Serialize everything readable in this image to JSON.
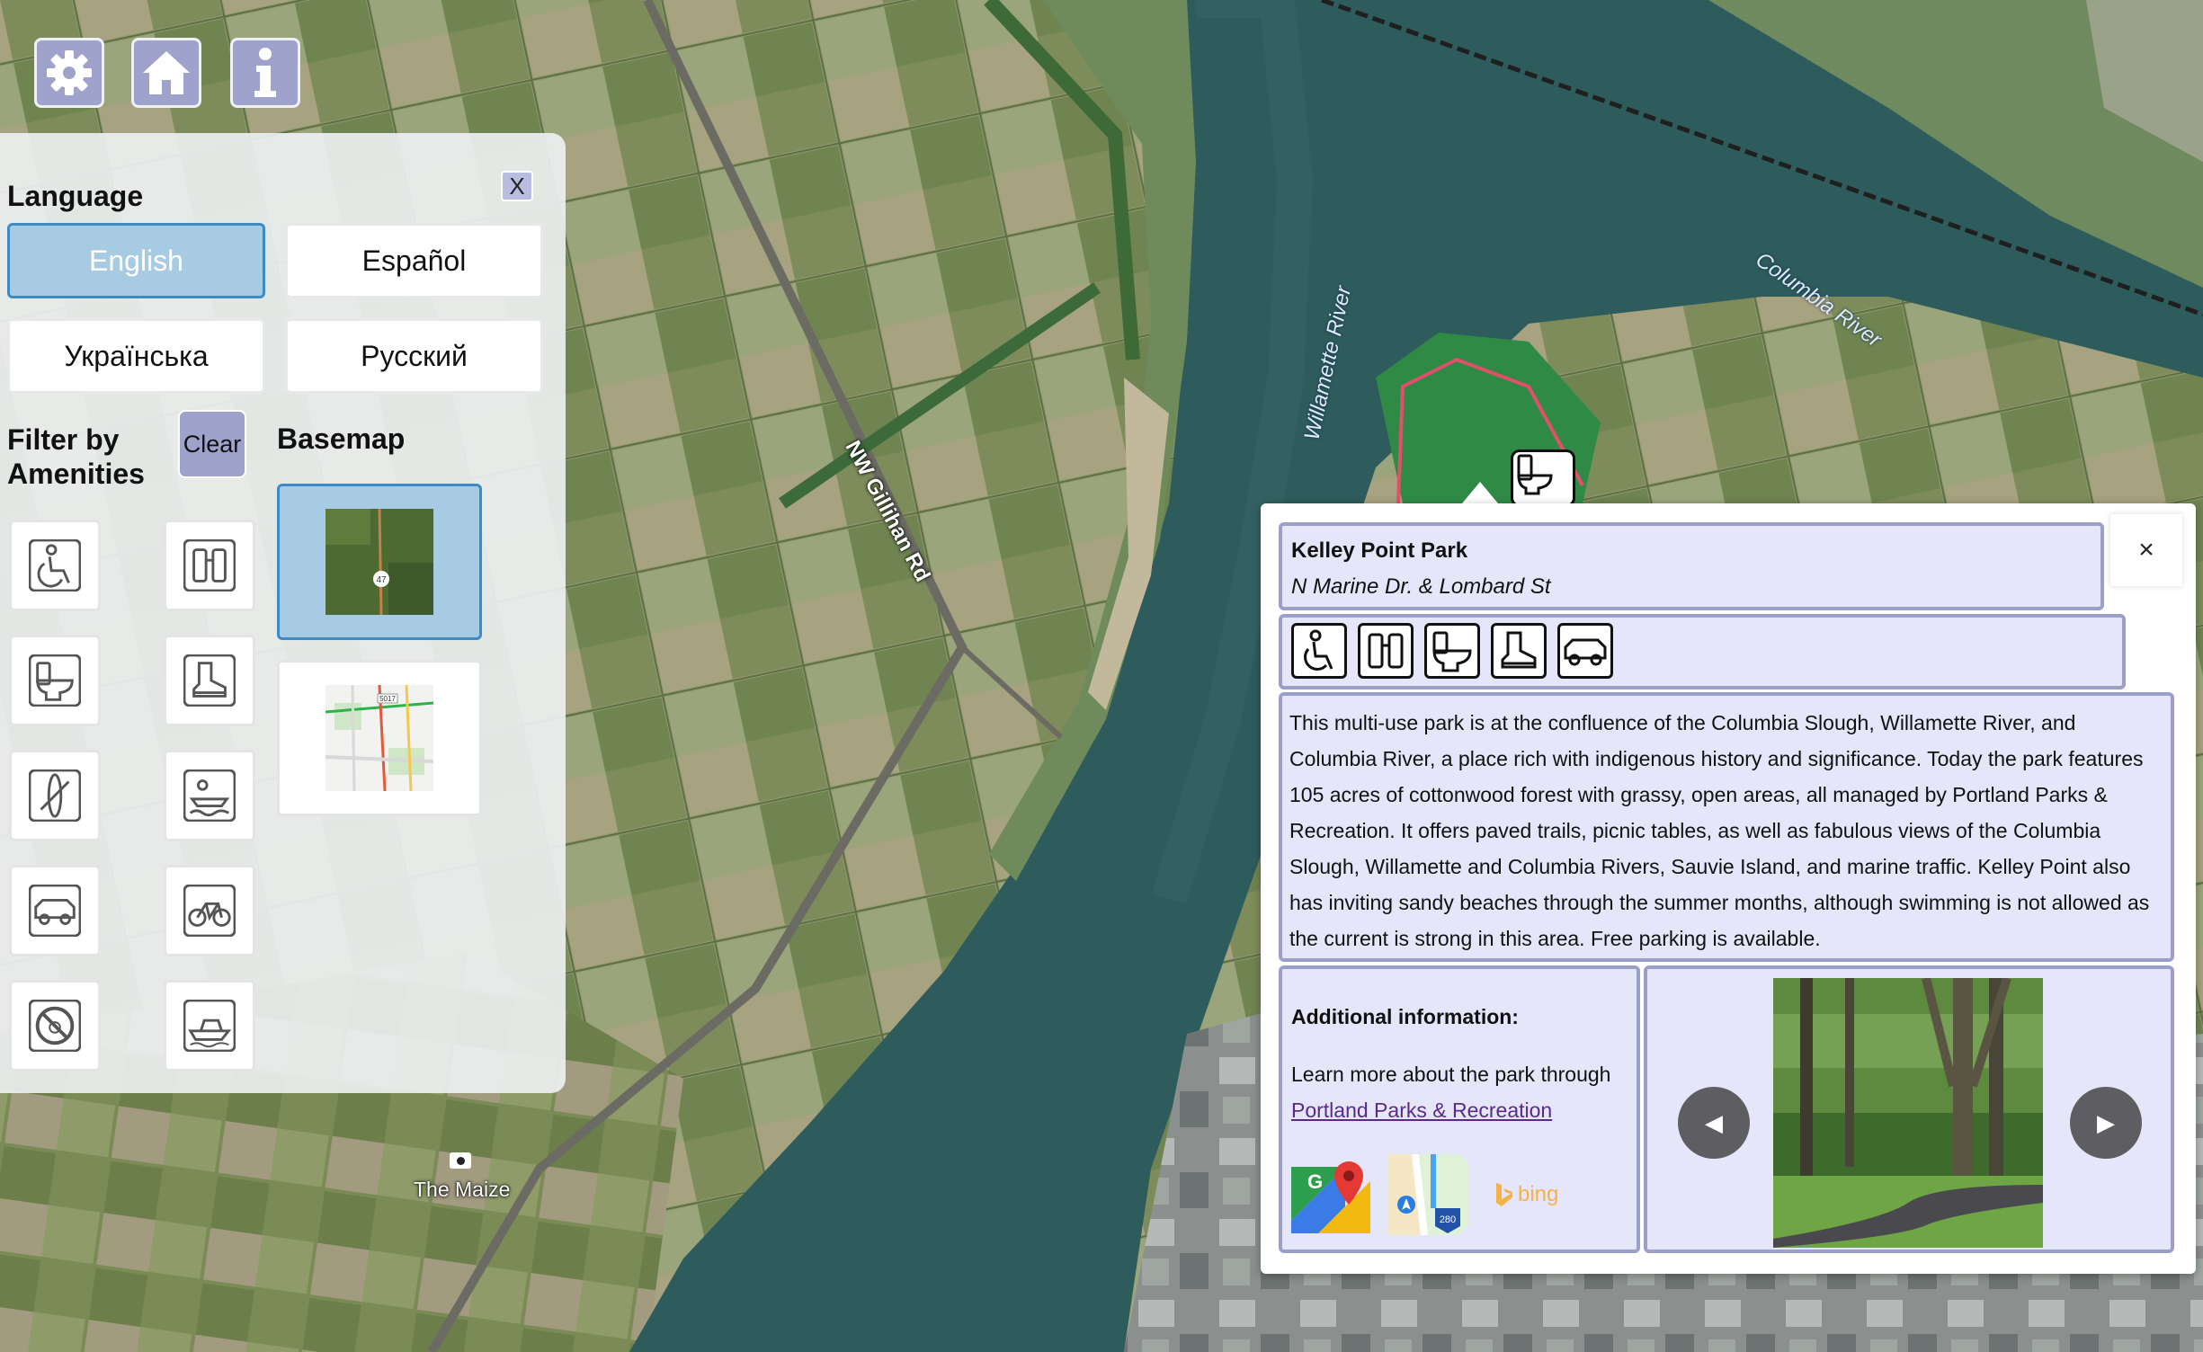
{
  "toolbar": {
    "settings_icon": "gear-icon",
    "home_icon": "home-icon",
    "info_icon": "info-icon",
    "button_color": "#9fa3cc"
  },
  "panel": {
    "close_label": "X",
    "language_title": "Language",
    "languages": [
      {
        "label": "English",
        "active": true
      },
      {
        "label": "Español",
        "active": false
      },
      {
        "label": "Українська",
        "active": false
      },
      {
        "label": "Русский",
        "active": false
      }
    ],
    "filter_title_line1": "Filter by",
    "filter_title_line2": "Amenities",
    "clear_label": "Clear",
    "basemap_title": "Basemap",
    "amenity_icons": [
      "wheelchair-icon",
      "binoculars-icon",
      "restroom-icon",
      "hiking-boot-icon",
      "kayak-icon",
      "boat-launch-icon",
      "parking-icon",
      "bicycle-icon",
      "no-pets-icon",
      "motorboat-icon"
    ],
    "basemaps": [
      {
        "name": "satellite-basemap",
        "active": true
      },
      {
        "name": "street-basemap",
        "active": false
      }
    ],
    "basemap_badge": "47",
    "street_badge": "5017"
  },
  "map": {
    "labels": {
      "willamette": "Willamette River",
      "columbia": "Columbia River",
      "road": "NW Gillihan Rd",
      "poi": "The Maize"
    }
  },
  "popup": {
    "close_label": "×",
    "title": "Kelley Point Park",
    "address": "N Marine Dr. & Lombard St",
    "amenity_icons": [
      "wheelchair-icon",
      "binoculars-icon",
      "restroom-icon",
      "hiking-boot-icon",
      "parking-icon"
    ],
    "description": "This multi-use park is at the confluence of the Columbia Slough, Willamette River, and Columbia River, a place rich with indigenous history and significance. Today the park features 105 acres of cottonwood forest with grassy, open areas, all managed by Portland Parks & Recreation. It offers paved trails, picnic tables, as well as fabulous views of the Columbia Slough, Willamette and Columbia Rivers, Sauvie Island, and marine traffic. Kelley Point also has inviting sandy beaches through the summer months, although swimming is not allowed as the current is strong in this area. Free parking is available.",
    "additional_title": "Additional information:",
    "learn_more": "Learn more about the park through",
    "link_text": "Portland Parks & Recreation",
    "map_apps": [
      "google-maps-icon",
      "apple-maps-icon",
      "bing-icon"
    ],
    "bing_label": "bing",
    "apple_maps_badge": "280",
    "prev_label": "◀",
    "next_label": "▶"
  }
}
